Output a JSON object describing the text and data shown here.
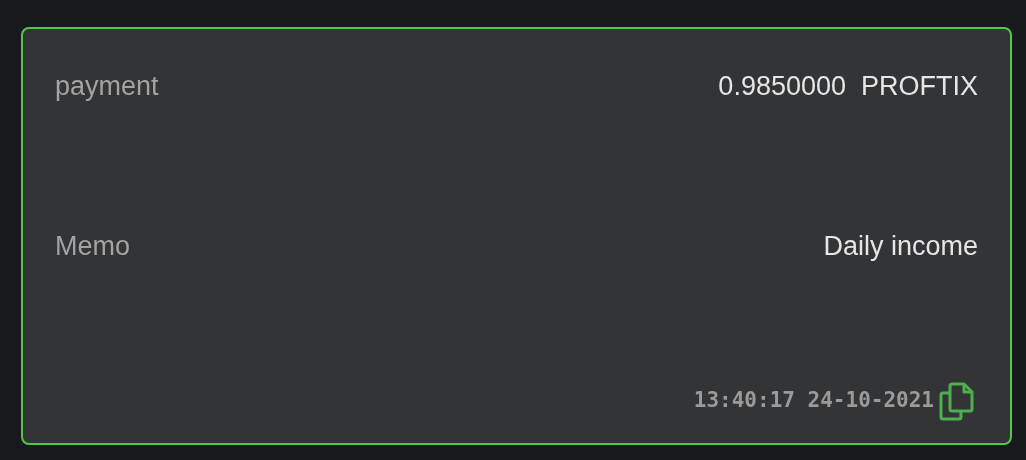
{
  "rows": [
    {
      "label": "payment",
      "value": "0.9850000  PROFTIX"
    },
    {
      "label": "Memo",
      "value": "Daily income"
    }
  ],
  "timestamp": "13:40:17 24-10-2021"
}
